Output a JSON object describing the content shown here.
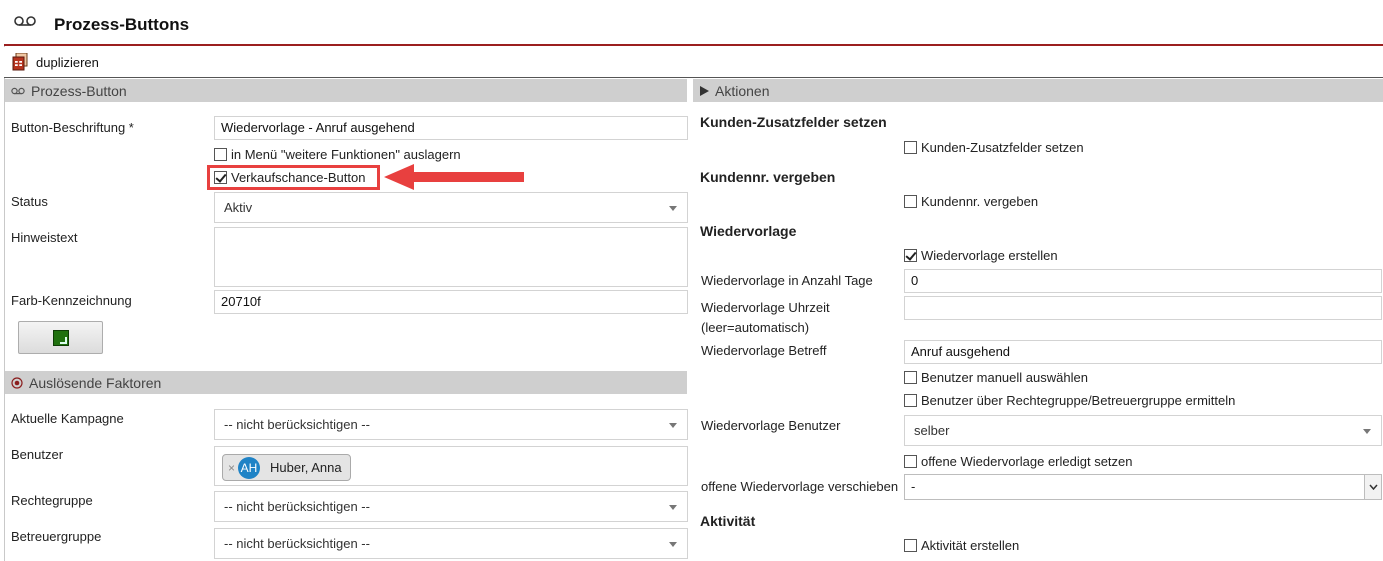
{
  "title": "Prozess-Buttons",
  "toolbar": {
    "duplicate_label": "duplizieren"
  },
  "left": {
    "section_title": "Prozess-Button",
    "button_label_field": {
      "label": "Button-Beschriftung *",
      "value": "Wiedervorlage - Anruf ausgehend"
    },
    "menu_checkbox": {
      "label": "in Menü \"weitere Funktionen\" auslagern",
      "checked": false
    },
    "sales_checkbox": {
      "label": "Verkaufschance-Button",
      "checked": true
    },
    "status": {
      "label": "Status",
      "value": "Aktiv"
    },
    "hint": {
      "label": "Hinweistext",
      "value": ""
    },
    "color": {
      "label": "Farb-Kennzeichnung",
      "value": "20710f",
      "swatch": "#20710f"
    },
    "triggers_title": "Auslösende Faktoren",
    "campaign": {
      "label": "Aktuelle Kampagne",
      "value": "-- nicht berücksichtigen --"
    },
    "user": {
      "label": "Benutzer",
      "tag_initials": "AH",
      "tag_name": "Huber, Anna"
    },
    "rights_group": {
      "label": "Rechtegruppe",
      "value": "-- nicht berücksichtigen --"
    },
    "care_group": {
      "label": "Betreuergruppe",
      "value": "-- nicht berücksichtigen --"
    }
  },
  "right": {
    "section_title": "Aktionen",
    "custom_fields": {
      "heading": "Kunden-Zusatzfelder setzen",
      "checkbox_label": "Kunden-Zusatzfelder setzen",
      "checked": false
    },
    "customer_no": {
      "heading": "Kundennr. vergeben",
      "checkbox_label": "Kundennr. vergeben",
      "checked": false
    },
    "followup": {
      "heading": "Wiedervorlage",
      "create_label": "Wiedervorlage erstellen",
      "create_checked": true,
      "days_label": "Wiedervorlage in Anzahl Tage",
      "days_value": "0",
      "time_label_1": "Wiedervorlage Uhrzeit",
      "time_label_2": "(leer=automatisch)",
      "time_value": "",
      "subject_label": "Wiedervorlage Betreff",
      "subject_value": "Anruf ausgehend",
      "manual_user_label": "Benutzer manuell auswählen",
      "rights_user_label": "Benutzer über Rechtegruppe/Betreuergruppe ermitteln",
      "user_label": "Wiedervorlage Benutzer",
      "user_value": "selber",
      "open_done_label": "offene Wiedervorlage erledigt setzen",
      "move_label": "offene Wiedervorlage verschieben",
      "move_value": "-"
    },
    "activity": {
      "heading": "Aktivität",
      "checkbox_label": "Aktivität erstellen",
      "checked": false
    }
  },
  "colors": {
    "accent_line": "#9b1f1f",
    "highlight": "#e8403f",
    "section_bg": "#cfcfcf"
  }
}
